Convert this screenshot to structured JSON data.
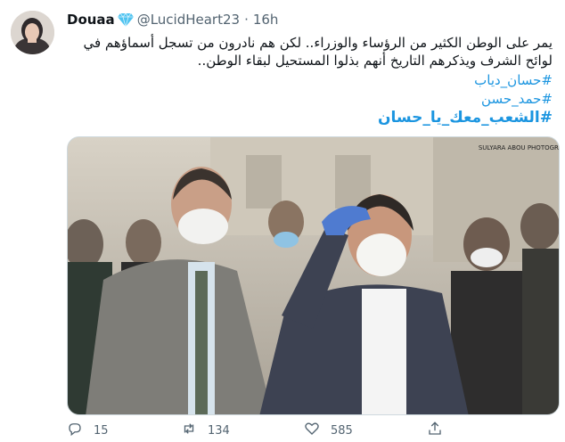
{
  "tweet": {
    "author_name": "Douaa",
    "handle": "@LucidHeart23",
    "separator": "·",
    "time": "16h",
    "text_lines": [
      "يمر على الوطن الكثير من الرؤساء والوزراء.. لكن هم نادرون من تسجل أسماؤهم في",
      "لوائح الشرف ويذكرهم التاريخ أنهم بذلوا المستحيل لبقاء الوطن.."
    ],
    "hashtags": [
      "#حسان_دياب",
      "#حمد_حسن",
      "#الشعب_معك_يا_حسان"
    ],
    "photo_watermark": "SULYARA ABOU PHOTOGRAPHY"
  },
  "actions": {
    "reply_count": "15",
    "retweet_count": "134",
    "like_count": "585"
  },
  "colors": {
    "hashtag": "#1b95e0",
    "secondary_text": "#536471",
    "verified_badge": "#4ec3f0"
  },
  "icons": [
    "verified-icon",
    "reply-icon",
    "retweet-icon",
    "like-icon",
    "share-icon"
  ]
}
